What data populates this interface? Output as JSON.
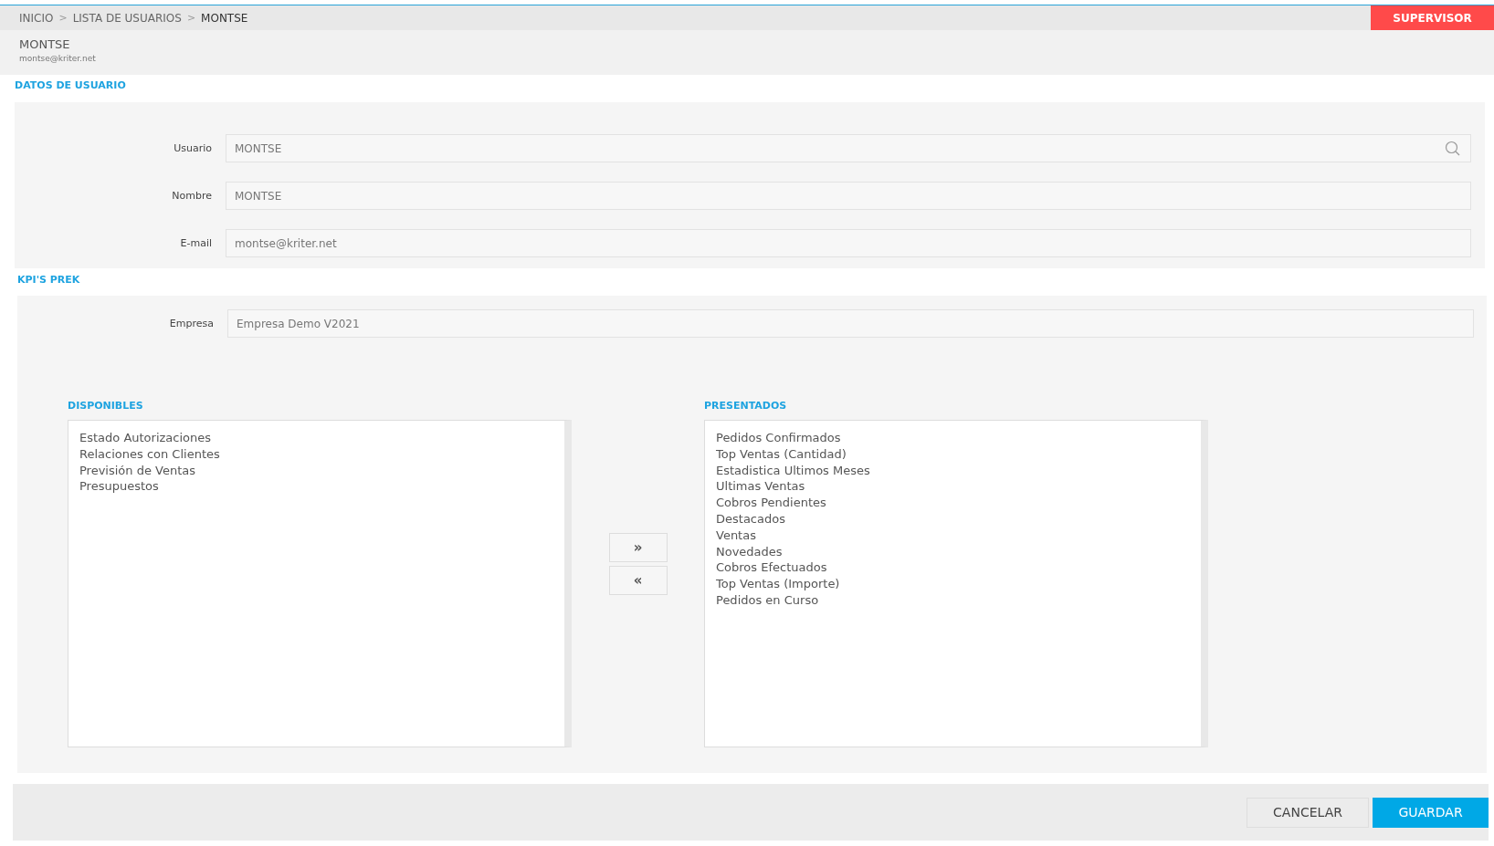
{
  "breadcrumb": [
    {
      "label": "INICIO",
      "current": false
    },
    {
      "label": "LISTA DE USUARIOS",
      "current": false
    },
    {
      "label": "MONTSE",
      "current": true
    }
  ],
  "breadcrumb_separator": ">",
  "role_badge": "SUPERVISOR",
  "header": {
    "name": "MONTSE",
    "email": "montse@kriter.net"
  },
  "user_section": {
    "title": "DATOS DE USUARIO",
    "fields": [
      {
        "label": "Usuario",
        "value": "MONTSE",
        "search": true
      },
      {
        "label": "Nombre",
        "value": "MONTSE",
        "search": false
      },
      {
        "label": "E-mail",
        "value": "montse@kriter.net",
        "search": false
      }
    ]
  },
  "kpi_section": {
    "title": "KPI'S PREK",
    "company": {
      "label": "Empresa",
      "value": "Empresa Demo V2021"
    },
    "available": {
      "title": "DISPONIBLES",
      "items": [
        "Estado Autorizaciones",
        "Relaciones con Clientes",
        "Previsión de Ventas",
        "Presupuestos"
      ]
    },
    "move_buttons": [
      "»",
      "«"
    ],
    "shown": {
      "title": "PRESENTADOS",
      "items": [
        "Pedidos Confirmados",
        "Top Ventas (Cantidad)",
        "Estadistica Ultimos Meses",
        "Ultimas Ventas",
        "Cobros Pendientes",
        "Destacados",
        "Ventas",
        "Novedades",
        "Cobros Efectuados",
        "Top Ventas (Importe)",
        "Pedidos en Curso"
      ]
    }
  },
  "footer": {
    "buttons": [
      {
        "label": "CANCELAR",
        "kind": "secondary"
      },
      {
        "label": "GUARDAR",
        "kind": "primary"
      }
    ]
  }
}
